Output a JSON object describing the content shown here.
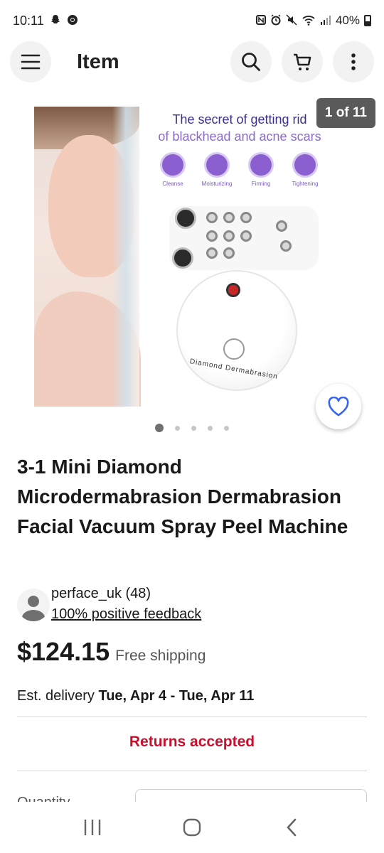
{
  "status_bar": {
    "time": "10:11",
    "battery": "40%",
    "left_icons": [
      "snapchat-icon",
      "chrome-icon"
    ],
    "right_icons": [
      "nfc-icon",
      "alarm-icon",
      "mute-icon",
      "wifi-icon",
      "signal-icon",
      "battery-icon"
    ]
  },
  "header": {
    "title": "Item",
    "menu_icon": "menu-icon",
    "search_icon": "search-icon",
    "cart_icon": "cart-icon",
    "more_icon": "more-vertical-icon"
  },
  "gallery": {
    "counter": "1 of 11",
    "headline_line1": "The secret of getting rid",
    "headline_line2": "of blackhead and acne scars",
    "features": [
      "Cleanse",
      "Moisturizing",
      "Firming",
      "Tightening"
    ],
    "brand_text": "Diamond Dermabrasion",
    "dot_count": 5,
    "active_dot": 0
  },
  "item": {
    "title": "3-1 Mini Diamond Microdermabrasion Dermabrasion Facial Vacuum Spray Peel Machine"
  },
  "seller": {
    "name": "perface_uk (48)",
    "feedback": "100% positive feedback"
  },
  "price": {
    "amount": "$124.15",
    "shipping": "Free shipping"
  },
  "delivery": {
    "prefix": "Est. delivery ",
    "range": "Tue, Apr 4 - Tue, Apr 11"
  },
  "returns": {
    "label": "Returns accepted"
  },
  "quantity": {
    "label": "Quantity"
  },
  "colors": {
    "returns_red": "#c8102e",
    "headline_purple": "#3d2e8c",
    "feature_purple": "#8b5fd0",
    "watch_blue": "#3665f3"
  }
}
